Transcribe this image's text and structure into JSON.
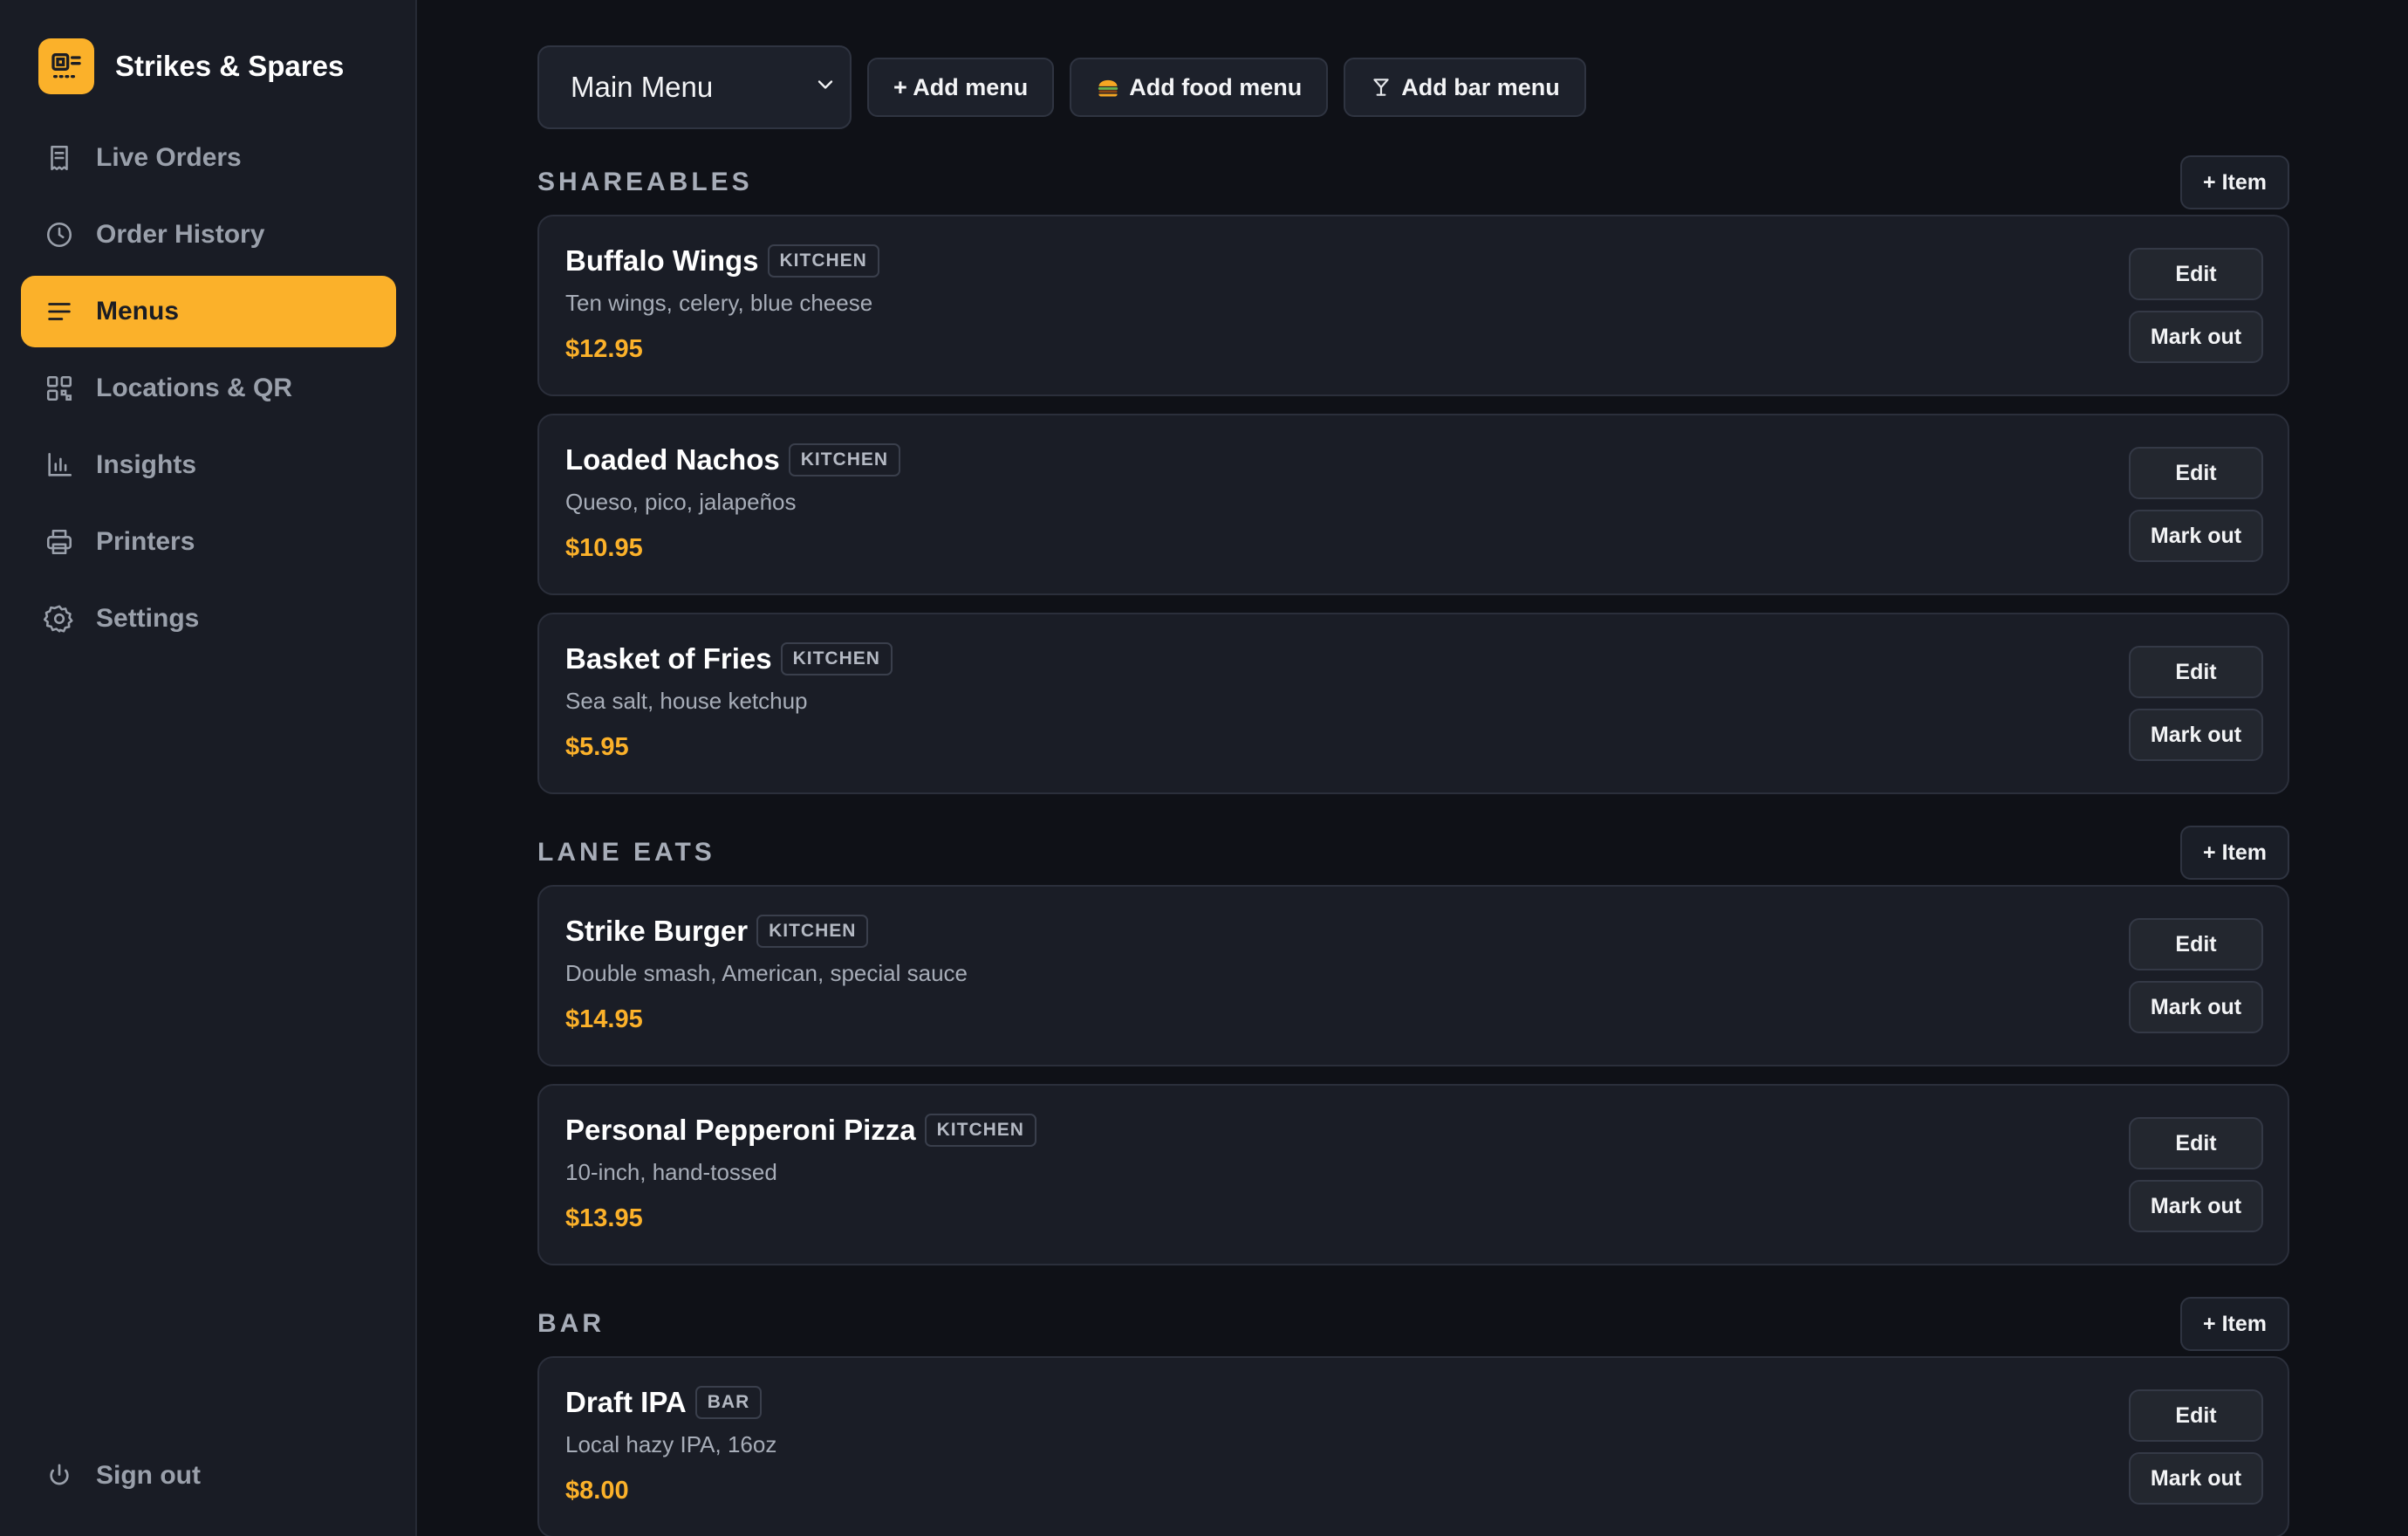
{
  "brand": {
    "name": "Strikes & Spares",
    "icon": "receipt-scanner-icon",
    "accent": "#fbb12a"
  },
  "nav": {
    "items": [
      {
        "label": "Live Orders",
        "icon": "receipt-icon",
        "active": false
      },
      {
        "label": "Order History",
        "icon": "clock-icon",
        "active": false
      },
      {
        "label": "Menus",
        "icon": "menu-lines-icon",
        "active": true
      },
      {
        "label": "Locations & QR",
        "icon": "qr-grid-icon",
        "active": false
      },
      {
        "label": "Insights",
        "icon": "bar-chart-icon",
        "active": false
      },
      {
        "label": "Printers",
        "icon": "printer-icon",
        "active": false
      },
      {
        "label": "Settings",
        "icon": "gear-icon",
        "active": false
      }
    ],
    "signout": {
      "label": "Sign out",
      "icon": "power-icon"
    }
  },
  "toolbar": {
    "menu_select": {
      "value": "Main Menu"
    },
    "add_menu": "+ Add menu",
    "add_food_menu": "Add food menu",
    "add_bar_menu": "Add bar menu"
  },
  "sections": [
    {
      "title": "SHAREABLES",
      "add_label": "+ Item",
      "items": [
        {
          "name": "Buffalo Wings",
          "badge": "KITCHEN",
          "desc": "Ten wings, celery, blue cheese",
          "price": "$12.95"
        },
        {
          "name": "Loaded Nachos",
          "badge": "KITCHEN",
          "desc": "Queso, pico, jalapeños",
          "price": "$10.95"
        },
        {
          "name": "Basket of Fries",
          "badge": "KITCHEN",
          "desc": "Sea salt, house ketchup",
          "price": "$5.95"
        }
      ]
    },
    {
      "title": "LANE EATS",
      "add_label": "+ Item",
      "items": [
        {
          "name": "Strike Burger",
          "badge": "KITCHEN",
          "desc": "Double smash, American, special sauce",
          "price": "$14.95"
        },
        {
          "name": "Personal Pepperoni Pizza",
          "badge": "KITCHEN",
          "desc": "10-inch, hand-tossed",
          "price": "$13.95"
        }
      ]
    },
    {
      "title": "BAR",
      "add_label": "+ Item",
      "items": [
        {
          "name": "Draft IPA",
          "badge": "BAR",
          "desc": "Local hazy IPA, 16oz",
          "price": "$8.00"
        }
      ]
    }
  ],
  "item_actions": {
    "edit": "Edit",
    "mark_out": "Mark out"
  }
}
